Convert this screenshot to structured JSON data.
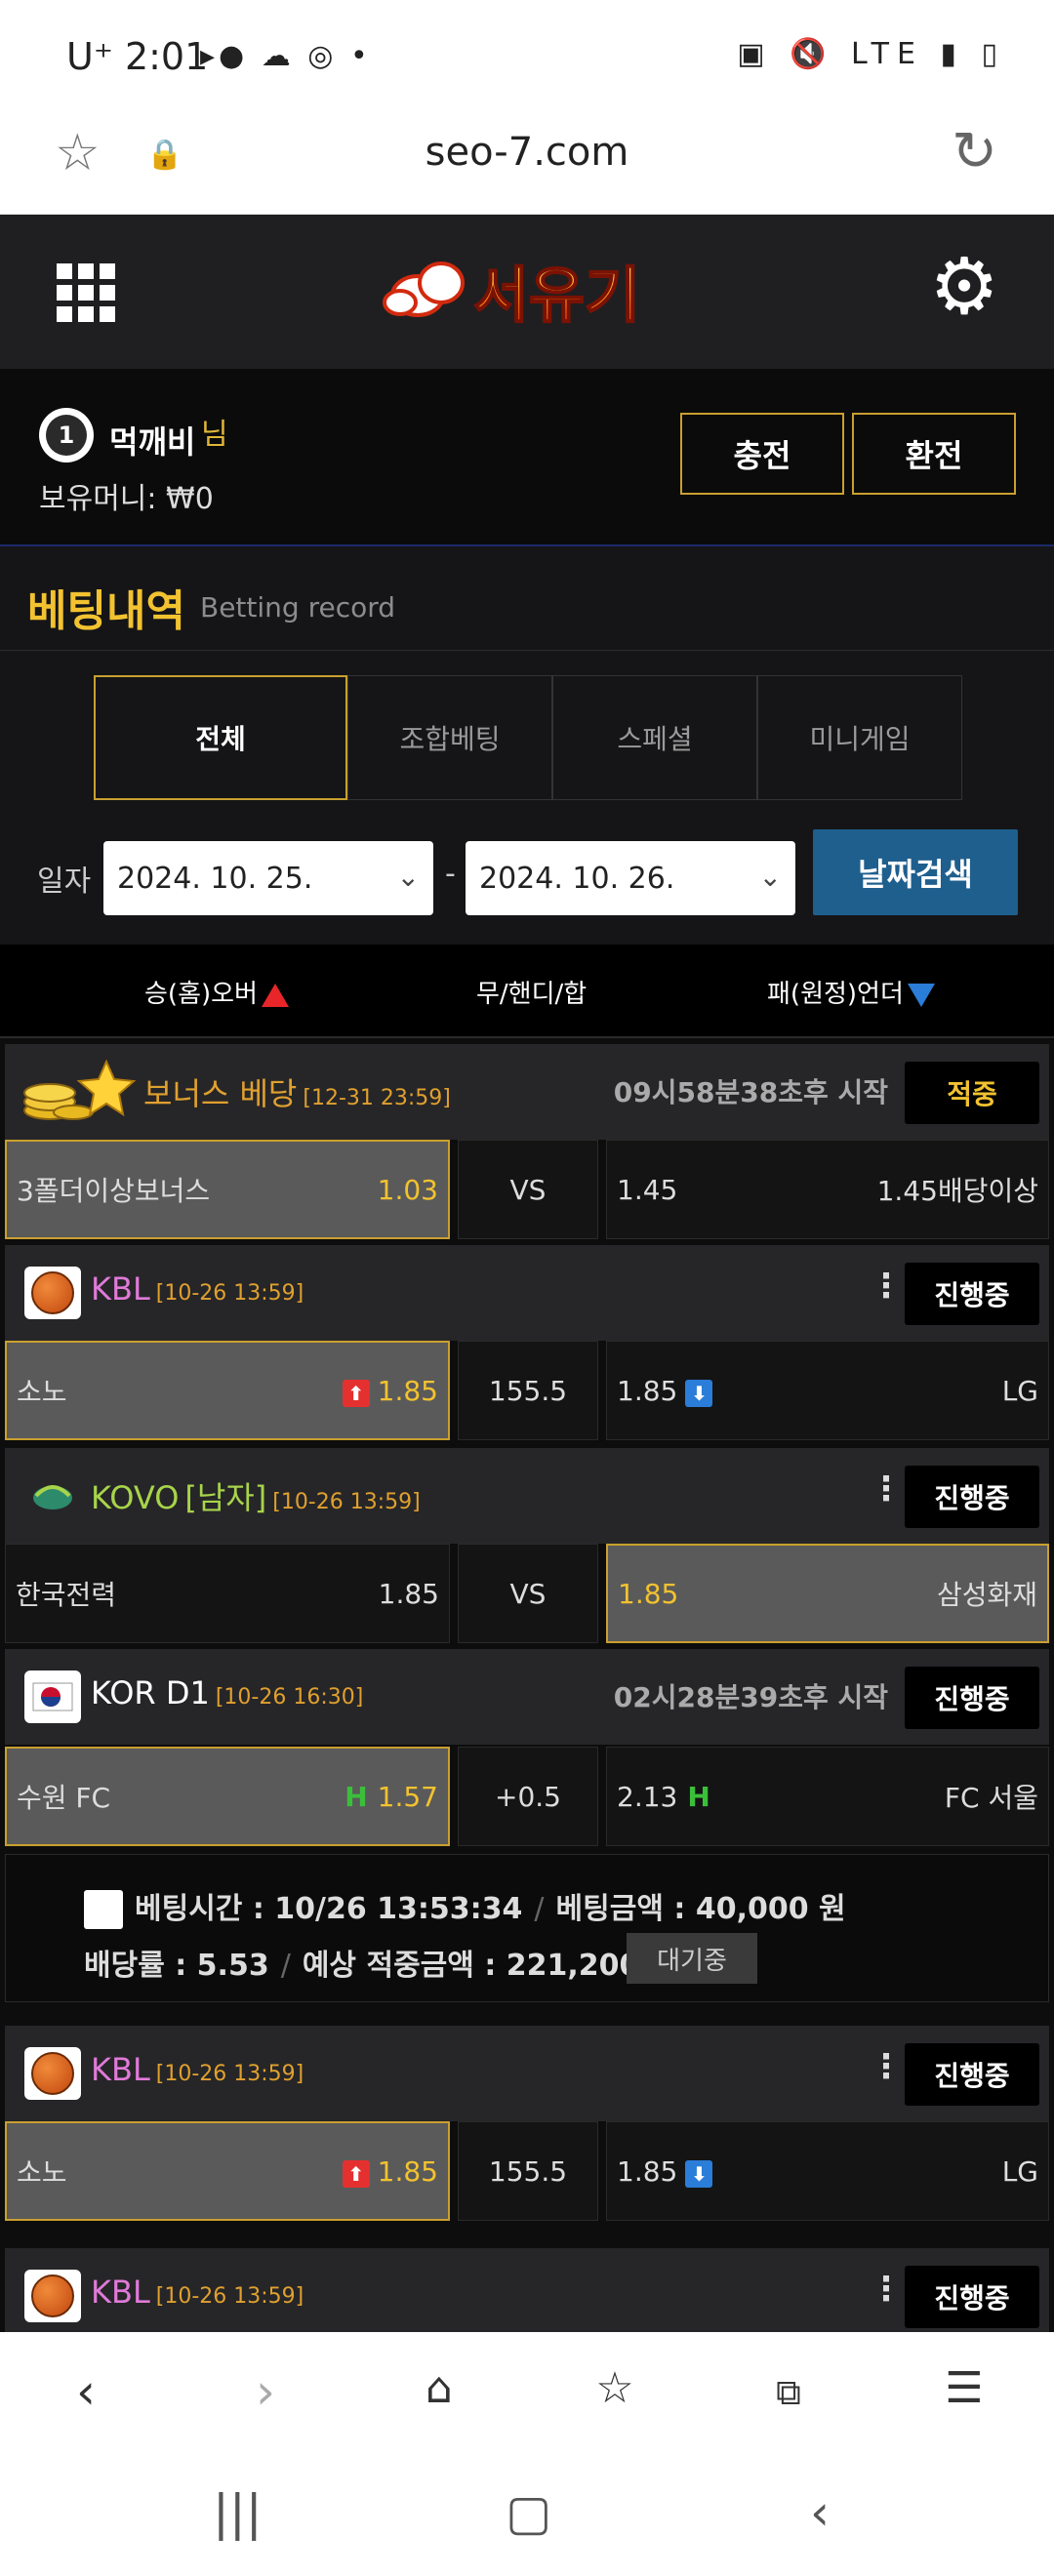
{
  "status_bar": {
    "time": "U⁺ 2:01",
    "notif_icons": "▸● ☁ ◎ •",
    "right_icons": "▣ 🔇 LTE ▮ ▯"
  },
  "url_bar": {
    "url": "seo-7.com"
  },
  "header": {
    "logo_text": "서유기"
  },
  "user": {
    "level": "1",
    "name": "먹깨비",
    "suffix": "님",
    "money": "보유머니: ₩0",
    "charge_label": "충전",
    "exchange_label": "환전"
  },
  "section": {
    "title": "베팅내역",
    "subtitle": "Betting record",
    "tabs": [
      "전체",
      "조합베팅",
      "스페셜",
      "미니게임"
    ],
    "date_label": "일자",
    "date_from": "2024. 10. 25.",
    "date_to": "2024. 10. 26.",
    "date_sep": "-",
    "search_label": "날짜검색"
  },
  "columns": {
    "home": "승(홈)오버",
    "draw": "무/핸디/합",
    "away": "패(원정)언더"
  },
  "matches": [
    {
      "league": "보너스 베당",
      "time": "[12-31 23:59]",
      "countdown": "09시58분38초후 시작",
      "status": "적중",
      "home": "3폴더이상보너스",
      "home_odd": "1.03",
      "mid": "VS",
      "away_odd": "1.45",
      "away": "1.45배당이상"
    },
    {
      "league": "KBL",
      "time": "[10-26 13:59]",
      "status": "진행중",
      "home": "소노",
      "home_odd": "1.85",
      "mid": "155.5",
      "away_odd": "1.85",
      "away": "LG"
    },
    {
      "league": "KOVO",
      "league_sub": "[남자]",
      "time": "[10-26 13:59]",
      "status": "진행중",
      "home": "한국전력",
      "home_odd": "1.85",
      "mid": "VS",
      "away_odd": "1.85",
      "away": "삼성화재"
    },
    {
      "league": "KOR D1",
      "time": "[10-26 16:30]",
      "countdown": "02시28분39초후 시작",
      "status": "진행중",
      "home": "수원 FC",
      "home_odd": "1.57",
      "mid": "+0.5",
      "away_odd": "2.13",
      "away": "FC 서울"
    },
    {
      "league": "KBL",
      "time": "[10-26 13:59]",
      "status": "진행중",
      "home": "소노",
      "home_odd": "1.85",
      "mid": "155.5",
      "away_odd": "1.85",
      "away": "LG"
    },
    {
      "league": "KBL",
      "time": "[10-26 13:59]",
      "status": "진행중"
    }
  ],
  "bet_info": {
    "bet_time": "베팅시간 : 10/26 13:53:34",
    "bet_amount": "베팅금액 : 40,000 원",
    "rate": "배당률 : 5.53",
    "expected": "예상 적중금액 : 221,200 원",
    "wait_label": "대기중",
    "separator": "/"
  },
  "h_mark": "H",
  "colors": {
    "accent_gold": "#f2c230",
    "search_blue": "#1f5f8e",
    "kbl_pink": "#e07ad8",
    "kovo_green": "#a8d44a"
  }
}
